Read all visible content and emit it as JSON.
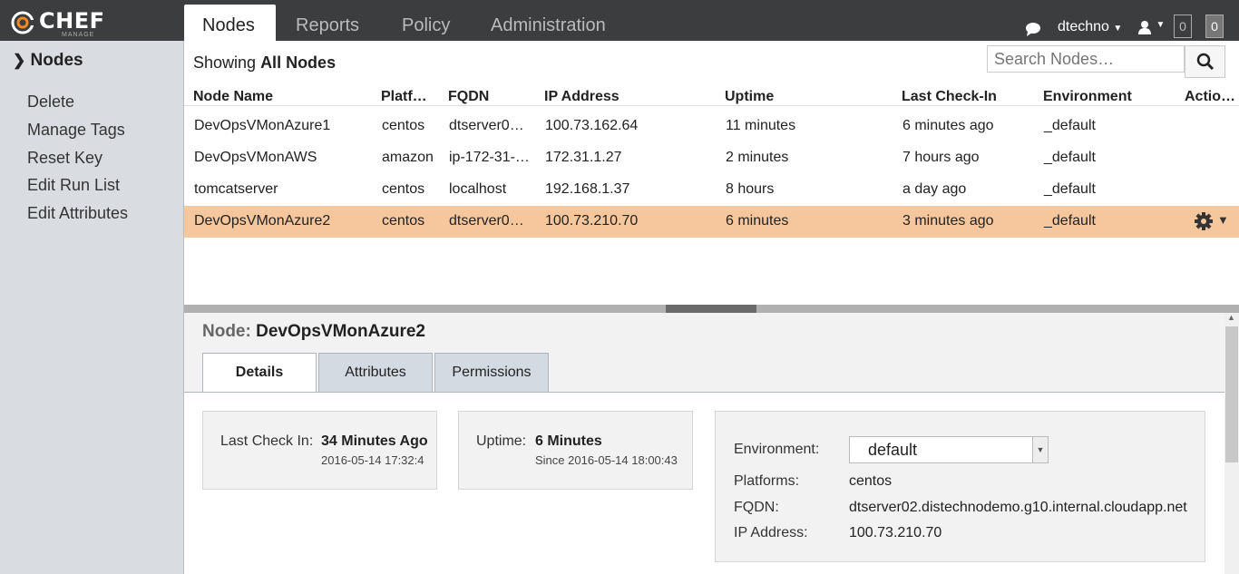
{
  "app": {
    "logo_text": "CHEF",
    "logo_sub": "MANAGE"
  },
  "nav": {
    "tabs": [
      "Nodes",
      "Reports",
      "Policy",
      "Administration"
    ],
    "active_tab": "Nodes"
  },
  "user": {
    "name": "dtechno",
    "counter1": "0",
    "counter2": "0"
  },
  "sidebar": {
    "heading": "Nodes",
    "items": [
      "Delete",
      "Manage Tags",
      "Reset Key",
      "Edit Run List",
      "Edit Attributes"
    ]
  },
  "list": {
    "showing_prefix": "Showing",
    "showing_bold": "All Nodes",
    "search_placeholder": "Search Nodes…",
    "columns": [
      "Node Name",
      "Platf…",
      "FQDN",
      "IP Address",
      "Uptime",
      "Last Check-In",
      "Environment",
      "Actio…"
    ],
    "rows": [
      [
        "DevOpsVMonAzure1",
        "centos",
        "dtserver0…",
        "100.73.162.64",
        "11 minutes",
        "6 minutes ago",
        "_default"
      ],
      [
        "DevOpsVMonAWS",
        "amazon",
        "ip-172-31-…",
        "172.31.1.27",
        "2 minutes",
        "7 hours ago",
        "_default"
      ],
      [
        "tomcatserver",
        "centos",
        "localhost",
        "192.168.1.37",
        "8 hours",
        "a day ago",
        "_default"
      ],
      [
        "DevOpsVMonAzure2",
        "centos",
        "dtserver0…",
        "100.73.210.70",
        "6 minutes",
        "3 minutes ago",
        "_default"
      ]
    ],
    "selected_row": 3
  },
  "detail": {
    "title_label": "Node:",
    "title_value": "DevOpsVMonAzure2",
    "tabs": [
      "Details",
      "Attributes",
      "Permissions"
    ],
    "active_tab": "Details",
    "checkin": {
      "label": "Last Check In:",
      "value": "34 Minutes Ago",
      "sub": "2016-05-14 17:32:4"
    },
    "uptime": {
      "label": "Uptime:",
      "value": "6 Minutes",
      "sub": "Since 2016-05-14 18:00:43"
    },
    "info": {
      "env_label": "Environment:",
      "env_value": "default",
      "platforms_label": "Platforms:",
      "platforms_value": "centos",
      "fqdn_label": "FQDN:",
      "fqdn_value": "dtserver02.distechnodemo.g10.internal.cloudapp.net",
      "ip_label": "IP Address:",
      "ip_value": "100.73.210.70"
    }
  },
  "colors": {
    "topbar": "#3c3d3e",
    "selected_row": "#f6c79c",
    "sidebar": "#d9dde2"
  }
}
